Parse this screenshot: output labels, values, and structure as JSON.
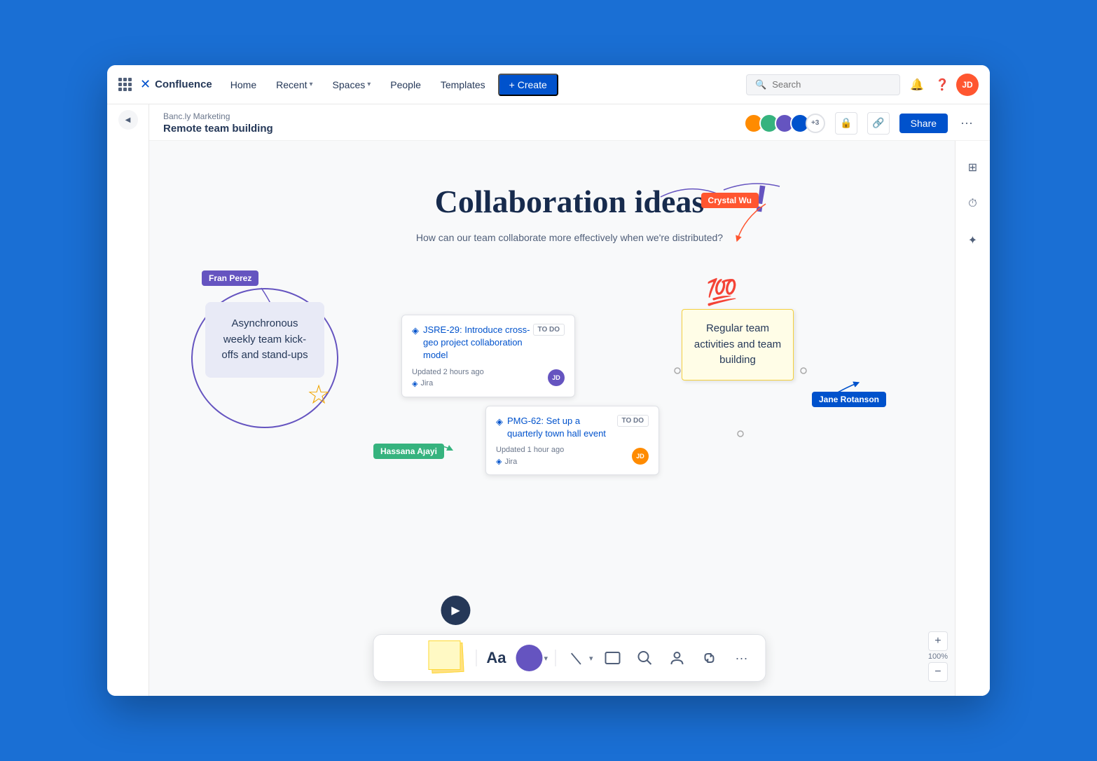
{
  "navbar": {
    "app_name": "Confluence",
    "home": "Home",
    "recent": "Recent",
    "spaces": "Spaces",
    "people": "People",
    "templates": "Templates",
    "create": "+ Create",
    "search_placeholder": "Search"
  },
  "breadcrumb": {
    "parent": "Banc.ly Marketing",
    "title": "Remote team building"
  },
  "header": {
    "collab_count": "+3",
    "share": "Share"
  },
  "canvas": {
    "title": "Collaboration ideas",
    "exclaim": "!",
    "subtitle": "How can our team collaborate more effectively when we're distributed?",
    "note_blue": {
      "text": "Asynchronous weekly team kick-offs and stand-ups"
    },
    "sticky_yellow": {
      "text": "Regular team activities and team building"
    },
    "user_labels": {
      "fran": "Fran Perez",
      "crystal": "Crystal Wu",
      "hassana": "Hassana Ajayi",
      "jane": "Jane Rotanson"
    },
    "jira_card_1": {
      "icon": "◉",
      "title": "JSRE-29: Introduce cross-geo project collaboration model",
      "status": "TO DO",
      "updated": "Updated 2 hours ago",
      "source": "Jira"
    },
    "jira_card_2": {
      "icon": "◉",
      "title": "PMG-62: Set up a quarterly town hall event",
      "status": "TO DO",
      "updated": "Updated 1 hour ago",
      "source": "Jira"
    }
  },
  "toolbar": {
    "text_aa": "Aa",
    "zoom_percent": "100%",
    "zoom_plus": "+",
    "zoom_minus": "−"
  }
}
